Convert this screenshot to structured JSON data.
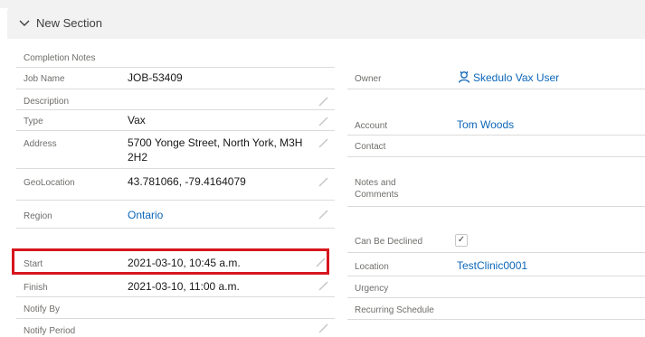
{
  "section": {
    "title": "New Section"
  },
  "left_fields": [
    {
      "label": "Completion Notes",
      "value": ""
    },
    {
      "label": "Job Name",
      "value": "JOB-53409"
    },
    {
      "label": "Description",
      "value": ""
    },
    {
      "label": "Type",
      "value": "Vax"
    },
    {
      "label": "Address",
      "value_line1": "5700 Yonge Street, North York, M3H",
      "value_line2": "2H2"
    },
    {
      "label": "GeoLocation",
      "value": "43.781066, -79.4164079"
    },
    {
      "label": "Region",
      "value": "Ontario"
    },
    {
      "label": "Start",
      "value": "2021-03-10, 10:45 a.m."
    },
    {
      "label": "Finish",
      "value": "2021-03-10, 11:00 a.m."
    },
    {
      "label": "Notify By",
      "value": ""
    },
    {
      "label": "Notify Period",
      "value": ""
    }
  ],
  "right_fields": [
    {
      "label": "Owner",
      "value": "Skedulo Vax User"
    },
    {
      "label": "Account",
      "value": "Tom Woods"
    },
    {
      "label": "Contact",
      "value": ""
    },
    {
      "label_line1": "Notes and",
      "label_line2": "Comments",
      "value": ""
    },
    {
      "label": "Can Be Declined",
      "checked": true,
      "check_glyph": "✓"
    },
    {
      "label": "Location",
      "value": "TestClinic0001"
    },
    {
      "label": "Urgency",
      "value": ""
    },
    {
      "label": "Recurring Schedule",
      "value": ""
    }
  ],
  "colors": {
    "link": "#0b66b8",
    "highlight": "#d7161e",
    "header_bg": "#f3f2f2"
  },
  "icons": {
    "chevron": "chevron-down-icon",
    "edit": "pencil-icon",
    "owner": "user-avatar-icon"
  }
}
